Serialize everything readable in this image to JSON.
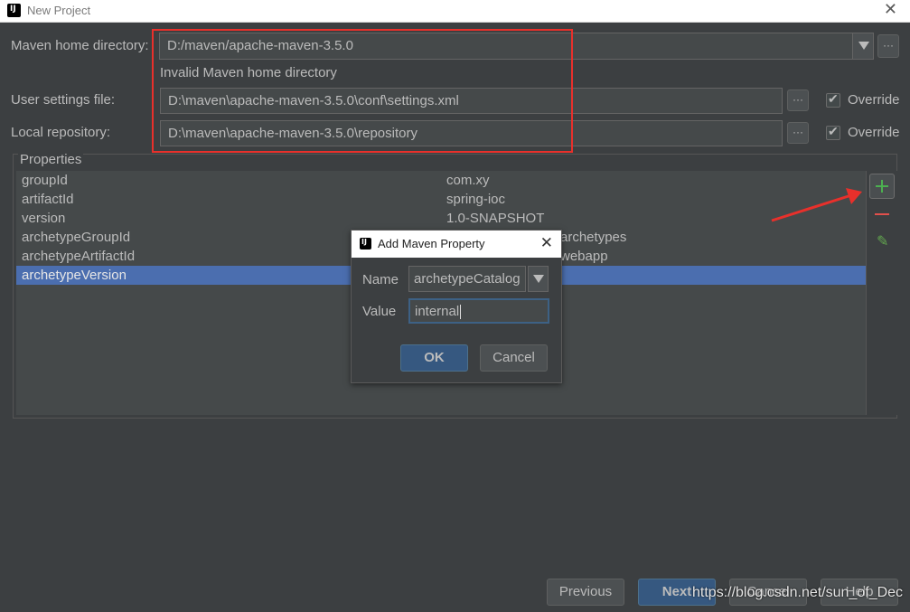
{
  "window": {
    "title": "New Project",
    "close_glyph": "✕"
  },
  "maven": {
    "home_label": "Maven home directory:",
    "home_value": "D:/maven/apache-maven-3.5.0",
    "error": "Invalid Maven home directory",
    "settings_label": "User settings file:",
    "settings_value": "D:\\maven\\apache-maven-3.5.0\\conf\\settings.xml",
    "repo_label": "Local repository:",
    "repo_value": "D:\\maven\\apache-maven-3.5.0\\repository",
    "override_label": "Override",
    "browse_label": "···"
  },
  "properties": {
    "title": "Properties",
    "rows": [
      {
        "key": "groupId",
        "value": "com.xy"
      },
      {
        "key": "artifactId",
        "value": "spring-ioc"
      },
      {
        "key": "version",
        "value": "1.0-SNAPSHOT"
      },
      {
        "key": "archetypeGroupId",
        "value": "archetypes"
      },
      {
        "key": "archetypeArtifactId",
        "value": "webapp"
      },
      {
        "key": "archetypeVersion",
        "value": ""
      }
    ]
  },
  "dialog": {
    "title": "Add Maven Property",
    "close_glyph": "✕",
    "name_label": "Name",
    "name_value": "archetypeCatalog",
    "value_label": "Value",
    "value_value": "internal",
    "ok_label": "OK",
    "cancel_label": "Cancel"
  },
  "footer": {
    "previous_label": "Previous",
    "next_label": "Next",
    "cancel_label": "Cancel",
    "help_label": "Help"
  },
  "watermark": "https://blog.csdn.net/sun_of_Dec",
  "colors": {
    "highlight_red": "#e8302b",
    "selection": "#4b6eaf",
    "add_green": "#4cb050",
    "remove_red": "#e1504c"
  }
}
